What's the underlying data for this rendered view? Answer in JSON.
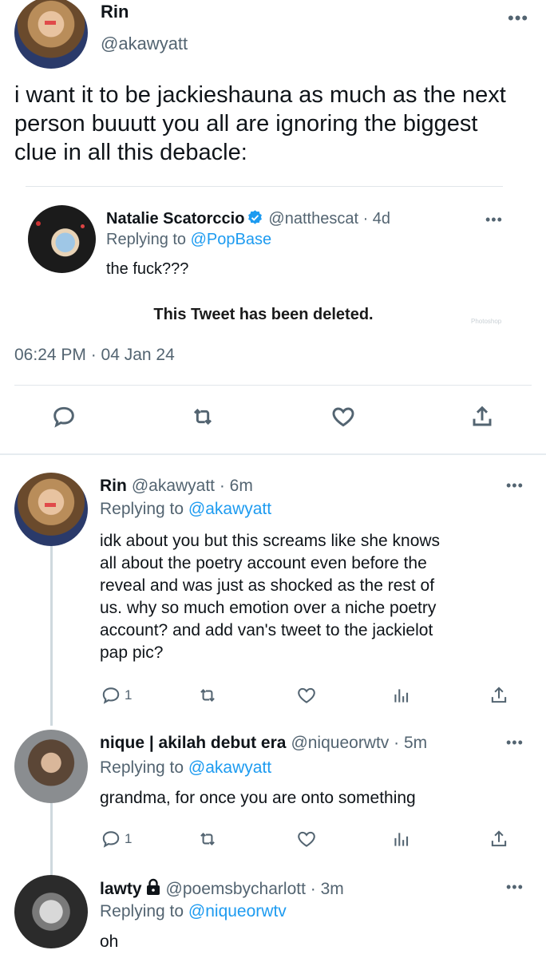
{
  "main_tweet": {
    "name": "Rin",
    "handle": "@akawyatt",
    "text": "i want it to be jackieshauna as much as the next person buuutt you all are ignoring the biggest clue in all this debacle:",
    "timestamp": "06:24 PM · 04 Jan 24",
    "quoted": {
      "name": "Natalie Scatorccio",
      "handle": "@natthescat · 4d",
      "replying_prefix": "Replying to",
      "replying_to": "@PopBase",
      "text": "the fuck???",
      "deleted_notice": "This Tweet has been deleted.",
      "watermark": "Photoshop"
    }
  },
  "replies": [
    {
      "name": "Rin",
      "handle": "@akawyatt · 6m",
      "replying_prefix": "Replying to",
      "replying_to": "@akawyatt",
      "text_lines": [
        "idk about you but this screams like she knows",
        "all about the poetry account  even before the",
        "reveal and was just as shocked as the rest of",
        "us. why so much emotion over a niche poetry",
        "account? and add van's tweet to the jackielot",
        "pap pic?"
      ],
      "reply_count": "1"
    },
    {
      "name": "nique | akilah debut era",
      "handle": "@niqueorwtv · 5m",
      "replying_prefix": "Replying to",
      "replying_to": "@akawyatt",
      "text_lines": [
        "grandma, for once you are onto something"
      ],
      "reply_count": "1"
    },
    {
      "name": "lawty",
      "handle": "@poemsbycharlott · 3m",
      "replying_prefix": "Replying to",
      "replying_to": "@niqueorwtv",
      "text_lines": [
        "oh"
      ]
    }
  ],
  "icons": {
    "more": "more-horizontal-icon",
    "reply": "reply-icon",
    "retweet": "retweet-icon",
    "like": "heart-icon",
    "views": "views-chart-icon",
    "share": "share-icon",
    "verified": "verified-badge-icon",
    "lock": "lock-icon"
  },
  "colors": {
    "text": "#0f1419",
    "secondary": "#536471",
    "accent": "#1d9bf0",
    "divider": "#e1e6ea"
  }
}
